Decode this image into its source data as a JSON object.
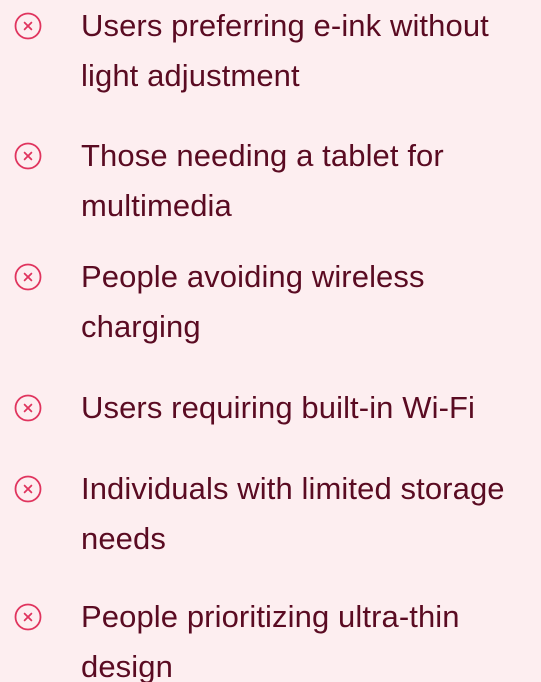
{
  "colors": {
    "background": "#FDEEF0",
    "text": "#5A0B22",
    "icon_accent": "#E0345E"
  },
  "items": [
    {
      "icon": "circle-x-icon",
      "label": "Users preferring e-ink without light adjustment"
    },
    {
      "icon": "circle-x-icon",
      "label": "Those needing a tablet for multimedia"
    },
    {
      "icon": "circle-x-icon",
      "label": "People avoiding wireless charging"
    },
    {
      "icon": "circle-x-icon",
      "label": "Users requiring built-in Wi-Fi"
    },
    {
      "icon": "circle-x-icon",
      "label": "Individuals with limited storage needs"
    },
    {
      "icon": "circle-x-icon",
      "label": "People prioritizing ultra-thin design"
    }
  ]
}
